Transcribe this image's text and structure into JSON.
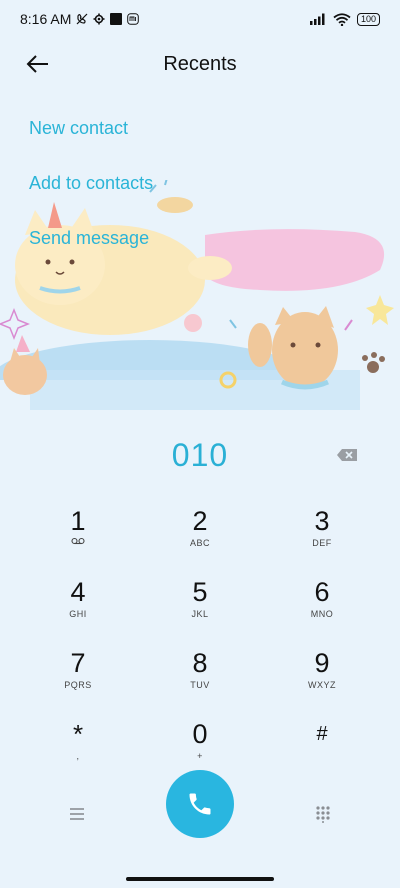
{
  "status_bar": {
    "time": "8:16 AM",
    "battery": "100",
    "icons": [
      "no-call-icon",
      "settings-gear-icon",
      "square-notification-icon",
      "mi-icon",
      "signal-icon",
      "wifi-icon",
      "battery-icon"
    ]
  },
  "header": {
    "title": "Recents",
    "back_icon": "arrow-left-icon"
  },
  "actions": {
    "new_contact": "New contact",
    "add_to_contacts": "Add to contacts",
    "send_message": "Send message"
  },
  "dialer": {
    "number": "010",
    "backspace_icon": "backspace-icon"
  },
  "keypad": {
    "keys": [
      {
        "digit": "1",
        "letters": ""
      },
      {
        "digit": "2",
        "letters": "ABC"
      },
      {
        "digit": "3",
        "letters": "DEF"
      },
      {
        "digit": "4",
        "letters": "GHI"
      },
      {
        "digit": "5",
        "letters": "JKL"
      },
      {
        "digit": "6",
        "letters": "MNO"
      },
      {
        "digit": "7",
        "letters": "PQRS"
      },
      {
        "digit": "8",
        "letters": "TUV"
      },
      {
        "digit": "9",
        "letters": "WXYZ"
      },
      {
        "digit": "*",
        "letters": ","
      },
      {
        "digit": "0",
        "letters": "+"
      },
      {
        "digit": "#",
        "letters": ""
      }
    ]
  },
  "bottom_bar": {
    "menu_icon": "menu-icon",
    "call_icon": "phone-icon",
    "dialpad_icon": "dialpad-icon"
  },
  "colors": {
    "background": "#e9f3fb",
    "accent": "#2ab4d7",
    "call_button": "#29b6e0"
  }
}
